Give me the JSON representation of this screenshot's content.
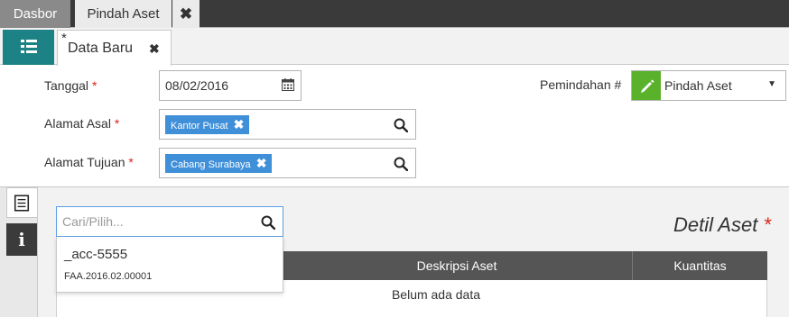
{
  "top_tabs": {
    "dasbor": "Dasbor",
    "pindah": "Pindah Aset",
    "close": "✖"
  },
  "doc_tab": {
    "modified_marker": "*",
    "label": "Data Baru",
    "close": "✖"
  },
  "form": {
    "tanggal": {
      "label": "Tanggal",
      "required": "*",
      "value": "08/02/2016"
    },
    "alamat_asal": {
      "label": "Alamat Asal",
      "required": "*",
      "tag": "Kantor Pusat",
      "tag_remove": "✖"
    },
    "alamat_tujuan": {
      "label": "Alamat Tujuan",
      "required": "*",
      "tag": "Cabang Surabaya",
      "tag_remove": "✖"
    },
    "pemindahan": {
      "label": "Pemindahan #",
      "value": "Pindah Aset",
      "caret": "▼"
    }
  },
  "detail": {
    "title": "Detil Aset",
    "required": "*",
    "search_placeholder": "Cari/Pilih...",
    "dropdown_option": {
      "code": "_acc-5555",
      "number": "FAA.2016.02.00001"
    },
    "columns": {
      "description": "Deskripsi Aset",
      "quantity": "Kuantitas"
    },
    "empty_text": "Belum ada data"
  },
  "colors": {
    "accent_teal": "#1d8286",
    "tag_blue": "#3f8fd9",
    "pencil_green": "#59b22a",
    "required_red": "#d9241c"
  },
  "icons": [
    "list-icon",
    "calendar-icon",
    "search-icon",
    "pencil-icon",
    "caret-down-icon",
    "document-icon",
    "info-icon"
  ]
}
